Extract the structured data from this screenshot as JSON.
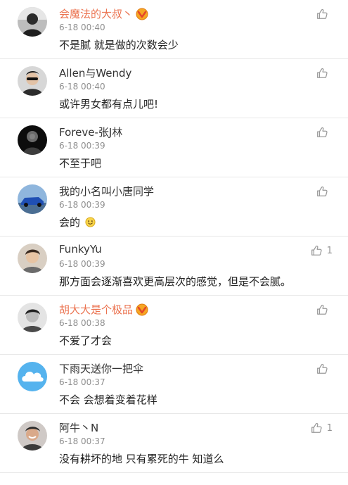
{
  "comments": [
    {
      "name": "会魔法的大叔丶",
      "vip": true,
      "time": "6-18 00:40",
      "text": "不是腻  就是做的次数会少",
      "likes": "",
      "avatar": "dark-person"
    },
    {
      "name": "Allen与Wendy",
      "vip": false,
      "time": "6-18 00:40",
      "text": "或许男女都有点儿吧!",
      "likes": "",
      "avatar": "person-sunglasses"
    },
    {
      "name": "Foreve-张J林",
      "vip": false,
      "time": "6-18 00:39",
      "text": "不至于吧",
      "likes": "",
      "avatar": "dark-silhouette"
    },
    {
      "name": "我的小名叫小唐同学",
      "vip": false,
      "time": "6-18 00:39",
      "text": "会的",
      "emoji": "smile",
      "likes": "",
      "avatar": "blue-car"
    },
    {
      "name": "FunkyYu",
      "vip": false,
      "time": "6-18 00:39",
      "text": "那方面会逐渐喜欢更高层次的感觉，但是不会腻。",
      "likes": "1",
      "avatar": "young-man"
    },
    {
      "name": "胡大大是个极品",
      "vip": true,
      "time": "6-18 00:38",
      "text": "不爱了才会",
      "likes": "",
      "avatar": "bw-portrait"
    },
    {
      "name": "下雨天送你一把伞",
      "vip": false,
      "time": "6-18 00:37",
      "text": "不会 会想着变着花样",
      "likes": "",
      "avatar": "cloud"
    },
    {
      "name": "阿牛丶N",
      "vip": false,
      "time": "6-18 00:37",
      "text": "没有耕坏的地 只有累死的牛 知道么",
      "likes": "1",
      "avatar": "smiling-man"
    }
  ],
  "colors": {
    "vip_name": "#eb7350",
    "name": "#333333",
    "time": "#8f8f8f",
    "text": "#222222",
    "like_icon": "#9a9a9a"
  }
}
